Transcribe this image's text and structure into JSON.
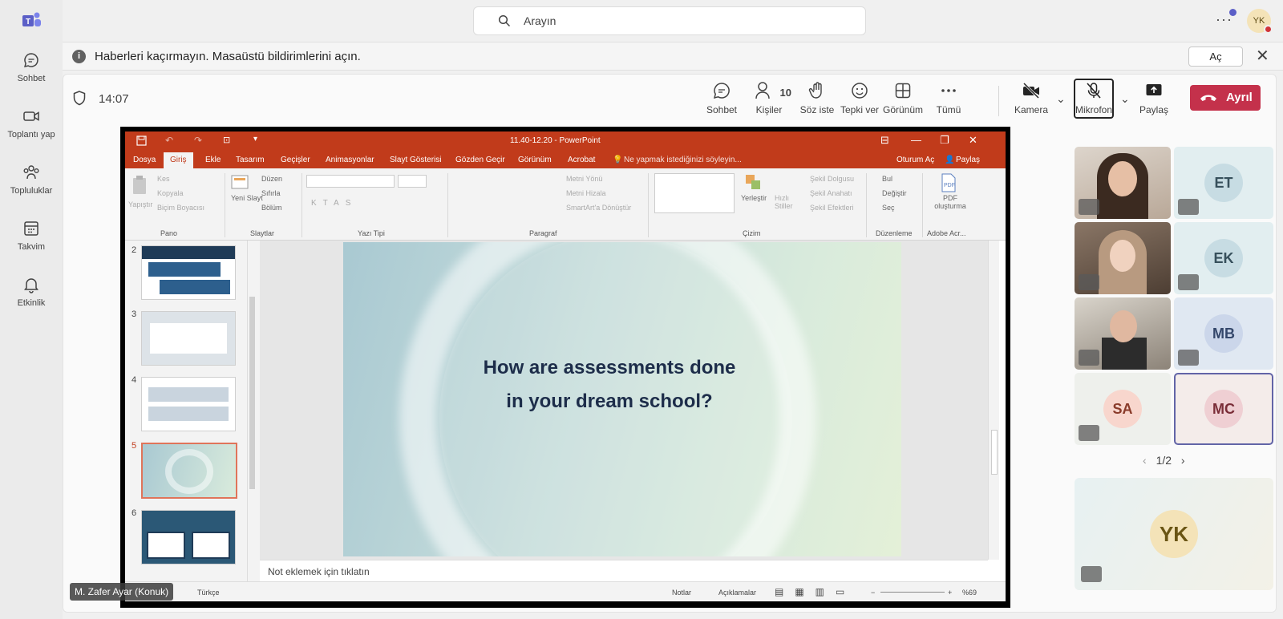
{
  "rail": {
    "items": [
      {
        "label": "Sohbet",
        "icon": "chat-icon"
      },
      {
        "label": "Toplantı yap",
        "icon": "video-icon"
      },
      {
        "label": "Topluluklar",
        "icon": "communities-icon"
      },
      {
        "label": "Takvim",
        "icon": "calendar-icon"
      },
      {
        "label": "Etkinlik",
        "icon": "bell-icon"
      }
    ]
  },
  "topbar": {
    "search_placeholder": "Arayın",
    "more": "···",
    "user_initials": "YK"
  },
  "notification": {
    "text": "Haberleri kaçırmayın. Masaüstü bildirimlerini açın.",
    "button": "Aç",
    "close": "✕"
  },
  "meeting": {
    "time": "14:07",
    "controls": {
      "chat": "Sohbet",
      "people": "Kişiler",
      "people_count": "10",
      "raise_hand": "Söz iste",
      "react": "Tepki ver",
      "view": "Görünüm",
      "more": "Tümü",
      "camera": "Kamera",
      "mic": "Mikrofon",
      "share": "Paylaş",
      "leave": "Ayrıl"
    }
  },
  "powerpoint": {
    "window_title": "11.40-12.20 - PowerPoint",
    "tabs": [
      "Dosya",
      "Giriş",
      "Ekle",
      "Tasarım",
      "Geçişler",
      "Animasyonlar",
      "Slayt Gösterisi",
      "Gözden Geçir",
      "Görünüm",
      "Acrobat"
    ],
    "tell_me": "Ne yapmak istediğinizi söyleyin...",
    "sign_in": "Oturum Aç",
    "share": "Paylaş",
    "ribbon": {
      "paste": "Yapıştır",
      "cut": "Kes",
      "copy": "Kopyala",
      "format_painter": "Biçim Boyacısı",
      "new_slide": "Yeni Slayt",
      "layout": "Düzen",
      "reset": "Sıfırla",
      "section": "Bölüm",
      "text_direction": "Metni Yönü",
      "align_text": "Metni Hizala",
      "smartart": "SmartArt'a Dönüştür",
      "arrange": "Yerleştir",
      "quick_styles": "Hızlı Stiller",
      "shape_fill": "Şekil Dolgusu",
      "shape_outline": "Şekil Anahatı",
      "shape_effects": "Şekil Efektleri",
      "find": "Bul",
      "replace": "Değiştir",
      "select": "Seç",
      "pdf": "PDF oluşturma",
      "groups": [
        "Pano",
        "Slaytlar",
        "Yazı Tipi",
        "Paragraf",
        "Çizim",
        "Düzenleme",
        "Adobe Acr..."
      ]
    },
    "thumbnails": [
      {
        "num": "2"
      },
      {
        "num": "3"
      },
      {
        "num": "4"
      },
      {
        "num": "5"
      },
      {
        "num": "6"
      }
    ],
    "slide_text_line1": "How are assessments done",
    "slide_text_line2": "in your dream school?",
    "notes_placeholder": "Not eklemek için tıklatın",
    "status": {
      "language": "Türkçe",
      "notes": "Notlar",
      "comments": "Açıklamalar",
      "zoom": "%69"
    }
  },
  "presenter_label": "M. Zafer Ayar (Konuk)",
  "participants": [
    {
      "initials": "",
      "video": true,
      "muted": true
    },
    {
      "initials": "ET",
      "video": false,
      "muted": true,
      "color": "#d7e6ea"
    },
    {
      "initials": "",
      "video": true,
      "muted": true
    },
    {
      "initials": "EK",
      "video": false,
      "muted": true,
      "color": "#d7e6ea"
    },
    {
      "initials": "",
      "video": true,
      "muted": true
    },
    {
      "initials": "MB",
      "video": false,
      "muted": true,
      "color": "#d5dff0"
    },
    {
      "initials": "SA",
      "video": false,
      "muted": true,
      "color": "#f8dcd6"
    },
    {
      "initials": "MC",
      "video": false,
      "muted": false,
      "color": "#f2d6d9"
    }
  ],
  "pager": "1/2",
  "self": {
    "initials": "YK"
  },
  "colors": {
    "brand": "#5b5fc7",
    "leave": "#c4314b",
    "ppt": "#c13b1b"
  }
}
